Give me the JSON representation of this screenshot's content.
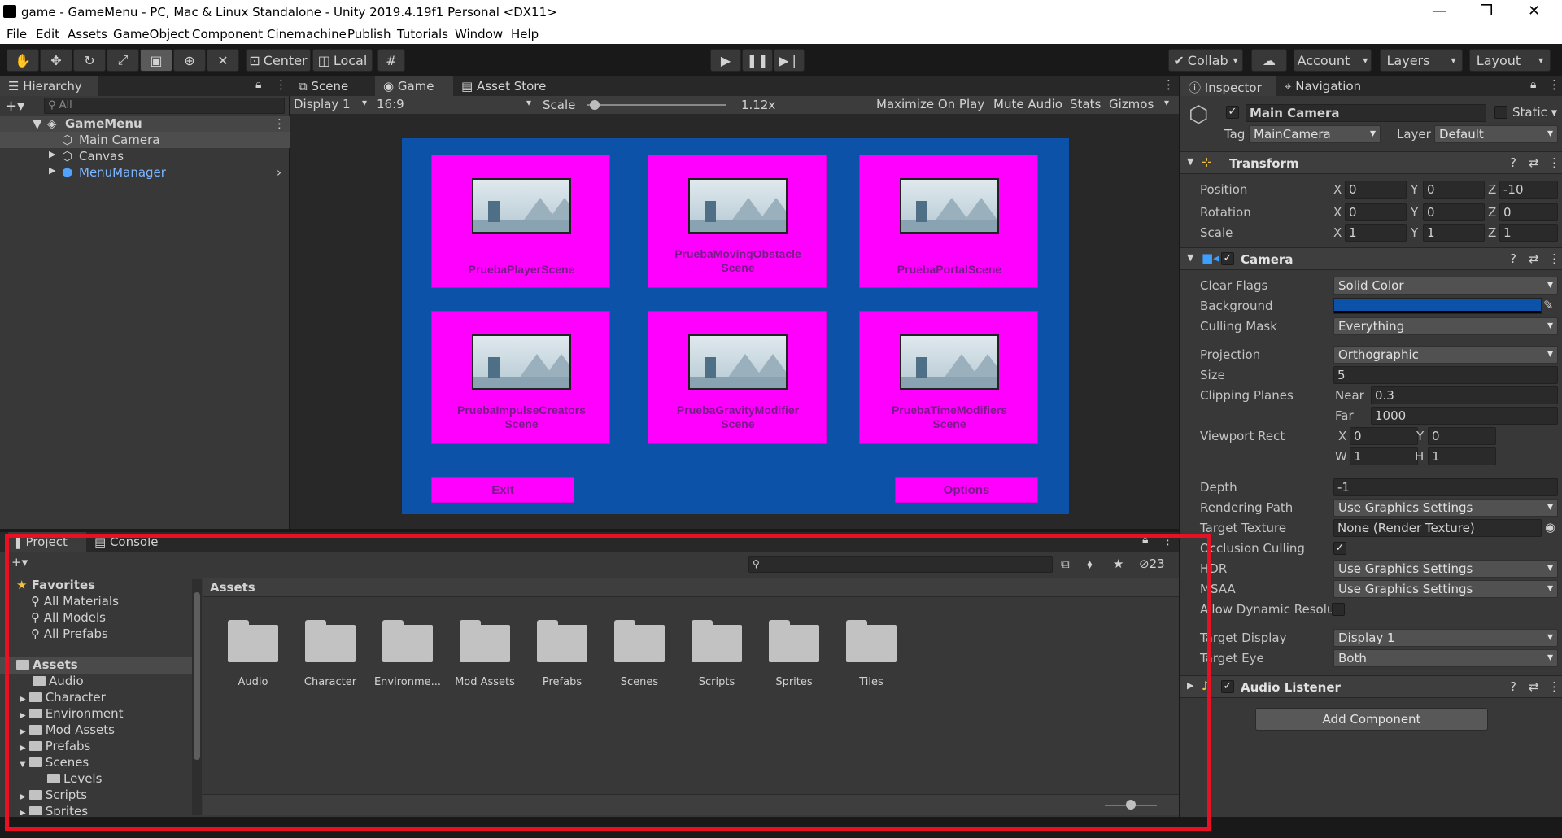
{
  "window": {
    "title": "game - GameMenu - PC, Mac & Linux Standalone - Unity 2019.4.19f1 Personal <DX11>",
    "controls": [
      "—",
      "❐",
      "✕"
    ]
  },
  "menubar": [
    "File",
    "Edit",
    "Assets",
    "GameObject",
    "Component",
    "Cinemachine",
    "Publish",
    "Tutorials",
    "Window",
    "Help"
  ],
  "toolbar": {
    "pivot": "Center",
    "space": "Local",
    "collab": "Collab",
    "account": "Account",
    "layers": "Layers",
    "layout": "Layout"
  },
  "hierarchy": {
    "tab": "Hierarchy",
    "search_placeholder": "All",
    "scene": "GameMenu",
    "items": [
      "Main Camera",
      "Canvas",
      "MenuManager"
    ]
  },
  "game_view": {
    "tabs": [
      "Scene",
      "Game",
      "Asset Store"
    ],
    "display": "Display 1",
    "aspect": "16:9",
    "scale_label": "Scale",
    "scale_value": "1.12x",
    "options": [
      "Maximize On Play",
      "Mute Audio",
      "Stats",
      "Gizmos"
    ],
    "scene_buttons": [
      [
        "PruebaPlayerScene"
      ],
      [
        "PruebaMovingObstacle",
        "Scene"
      ],
      [
        "PruebaPortalScene"
      ],
      [
        "PruebaImpulseCreators",
        "Scene"
      ],
      [
        "PruebaGravityModifier",
        "Scene"
      ],
      [
        "PruebaTimeModifiers",
        "Scene"
      ]
    ],
    "exit_label": "Exit",
    "options_label": "Options"
  },
  "inspector": {
    "tabs": [
      "Inspector",
      "Navigation"
    ],
    "object_name": "Main Camera",
    "static_label": "Static",
    "tag_label": "Tag",
    "tag_value": "MainCamera",
    "layer_label": "Layer",
    "layer_value": "Default",
    "transform": {
      "title": "Transform",
      "position_label": "Position",
      "rotation_label": "Rotation",
      "scale_label": "Scale",
      "position": [
        "0",
        "0",
        "-10"
      ],
      "rotation": [
        "0",
        "0",
        "0"
      ],
      "scale": [
        "1",
        "1",
        "1"
      ]
    },
    "camera": {
      "title": "Camera",
      "clear_flags_label": "Clear Flags",
      "clear_flags": "Solid Color",
      "background_label": "Background",
      "background_color": "#0c52a8",
      "culling_mask_label": "Culling Mask",
      "culling_mask": "Everything",
      "projection_label": "Projection",
      "projection": "Orthographic",
      "size_label": "Size",
      "size": "5",
      "clipping_label": "Clipping Planes",
      "near_label": "Near",
      "near": "0.3",
      "far_label": "Far",
      "far": "1000",
      "viewport_label": "Viewport Rect",
      "viewport": {
        "x": "0",
        "y": "0",
        "w": "1",
        "h": "1"
      },
      "depth_label": "Depth",
      "depth": "-1",
      "rendering_path_label": "Rendering Path",
      "rendering_path": "Use Graphics Settings",
      "target_texture_label": "Target Texture",
      "target_texture": "None (Render Texture)",
      "occlusion_label": "Occlusion Culling",
      "hdr_label": "HDR",
      "hdr": "Use Graphics Settings",
      "msaa_label": "MSAA",
      "msaa": "Use Graphics Settings",
      "dynamic_res_label": "Allow Dynamic Resolu",
      "target_display_label": "Target Display",
      "target_display": "Display 1",
      "target_eye_label": "Target Eye",
      "target_eye": "Both"
    },
    "audio_listener": "Audio Listener",
    "add_component": "Add Component"
  },
  "project": {
    "tabs": [
      "Project",
      "Console"
    ],
    "hidden_count": "23",
    "favorites_label": "Favorites",
    "favorites": [
      "All Materials",
      "All Models",
      "All Prefabs"
    ],
    "assets_label": "Assets",
    "tree": [
      "Audio",
      "Character",
      "Environment",
      "Mod Assets",
      "Prefabs",
      "Scenes",
      "Levels",
      "Scripts",
      "Sprites"
    ],
    "breadcrumb": "Assets",
    "folders": [
      "Audio",
      "Character",
      "Environme...",
      "Mod Assets",
      "Prefabs",
      "Scenes",
      "Scripts",
      "Sprites",
      "Tiles"
    ]
  }
}
